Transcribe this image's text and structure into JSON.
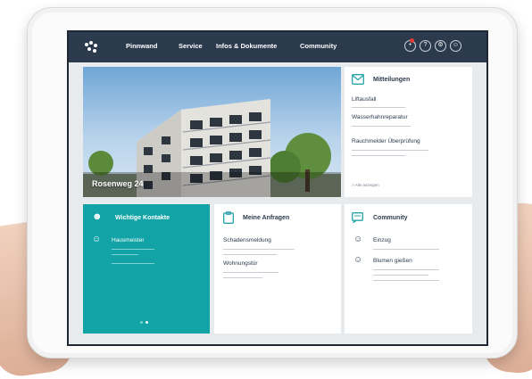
{
  "nav": {
    "items": [
      "Pinnwand",
      "Service",
      "Infos & Dokumente",
      "Community"
    ]
  },
  "hero": {
    "caption": "Rosenweg 24"
  },
  "mitteilungen": {
    "title": "Mitteilungen",
    "items": [
      "Liftausfall",
      "Wasserhahnreparatur",
      "Rauchmelder Überprüfung"
    ],
    "more_link": "> Alle anzeigen"
  },
  "kontakte": {
    "title": "Wichtige Kontakte",
    "person": "Hausmeister"
  },
  "anfragen": {
    "title": "Meine Anfragen",
    "items": [
      "Schadensmeldung",
      "Wohnungstür"
    ]
  },
  "community": {
    "title": "Community",
    "items": [
      "Einzug",
      "Blumen gießen"
    ]
  },
  "colors": {
    "nav": "#2c3a4e",
    "accent": "#11a3a6",
    "notification": "#e53935"
  }
}
